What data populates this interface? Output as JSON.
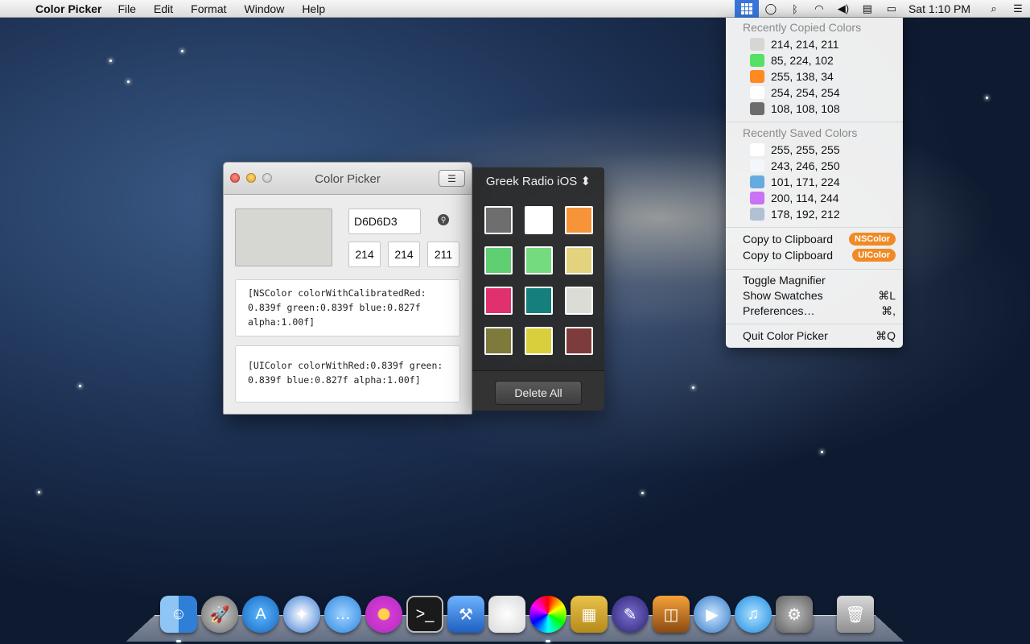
{
  "menubar": {
    "app_name": "Color Picker",
    "menus": [
      "File",
      "Edit",
      "Format",
      "Window",
      "Help"
    ],
    "clock": "Sat 1:10 PM"
  },
  "dropdown": {
    "recent_copied_header": "Recently Copied Colors",
    "recent_copied": [
      {
        "label": "214, 214, 211",
        "color": "#d6d6d3"
      },
      {
        "label": "85, 224, 102",
        "color": "#55e066"
      },
      {
        "label": "255, 138, 34",
        "color": "#ff8a22"
      },
      {
        "label": "254, 254, 254",
        "color": "#fefefe"
      },
      {
        "label": "108, 108, 108",
        "color": "#6c6c6c"
      }
    ],
    "recent_saved_header": "Recently Saved Colors",
    "recent_saved": [
      {
        "label": "255, 255, 255",
        "color": "#ffffff"
      },
      {
        "label": "243, 246, 250",
        "color": "#f3f6fa"
      },
      {
        "label": "101, 171, 224",
        "color": "#65abe0"
      },
      {
        "label": "200, 114, 244",
        "color": "#c872f4"
      },
      {
        "label": "178, 192, 212",
        "color": "#b2c0d4"
      }
    ],
    "copy_clipboard": "Copy to Clipboard",
    "nscolor_badge": "NSColor",
    "uicolor_badge": "UIColor",
    "toggle_magnifier": "Toggle Magnifier",
    "show_swatches": "Show Swatches",
    "show_swatches_shortcut": "⌘L",
    "preferences": "Preferences…",
    "preferences_shortcut": "⌘,",
    "quit": "Quit Color Picker",
    "quit_shortcut": "⌘Q"
  },
  "window": {
    "title": "Color Picker",
    "preview_color": "#d6d6d3",
    "hex": "D6D6D3",
    "r": "214",
    "g": "214",
    "b": "211",
    "nscolor_code": "[NSColor colorWithCalibratedRed:\n0.839f green:0.839f blue:0.827f\nalpha:1.00f]",
    "uicolor_code": "[UIColor colorWithRed:0.839f green:\n0.839f blue:0.827f alpha:1.00f]"
  },
  "swatches": {
    "palette_name": "Greek Radio iOS",
    "colors": [
      "#6e6e6e",
      "#ffffff",
      "#f7943a",
      "#5fcf72",
      "#74db7e",
      "#e3d27e",
      "#e0306e",
      "#147f7c",
      "#dcdcd7",
      "#7d7a3c",
      "#d9cf3c",
      "#7e3b3c"
    ],
    "delete_label": "Delete All"
  },
  "dock": {
    "icons": [
      "finder-icon",
      "launchpad-icon",
      "app-store-icon",
      "safari-icon",
      "messages-icon",
      "flower-app-icon",
      "terminal-icon",
      "xcode-icon",
      "pitcher-app-icon",
      "color-picker-icon",
      "transmit-icon",
      "feather-app-icon",
      "iphoto-icon",
      "quicktime-icon",
      "itunes-icon",
      "system-preferences-icon",
      "trash-icon"
    ]
  }
}
